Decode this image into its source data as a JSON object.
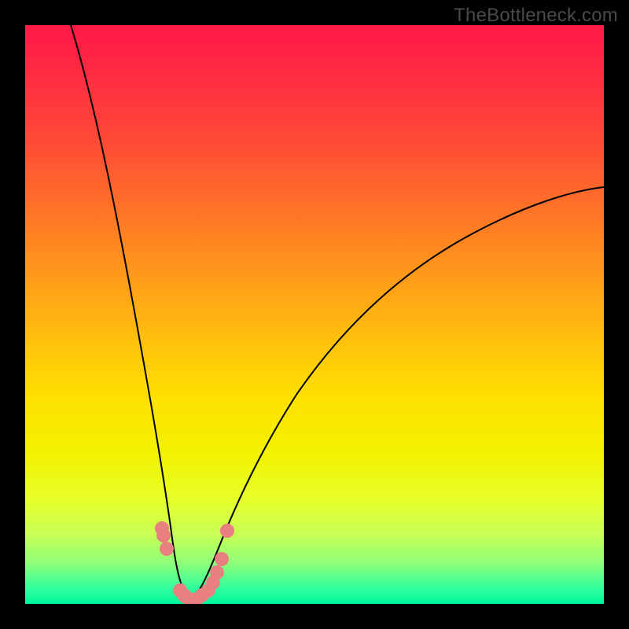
{
  "watermark": "TheBottleneck.com",
  "chart_data": {
    "type": "line",
    "title": "",
    "xlabel": "",
    "ylabel": "",
    "xlim": [
      0,
      100
    ],
    "ylim": [
      0,
      100
    ],
    "series": [
      {
        "name": "left-curve",
        "x": [
          8,
          10,
          12,
          14,
          16,
          18,
          20,
          22,
          23.5,
          24.5,
          25,
          25.5,
          26,
          27,
          28,
          29
        ],
        "y": [
          100,
          90,
          80,
          70,
          60,
          50,
          40,
          30,
          22,
          16,
          12,
          8,
          5,
          2.5,
          1,
          0
        ]
      },
      {
        "name": "right-curve",
        "x": [
          29,
          30,
          31,
          32,
          33.5,
          35,
          37,
          40,
          45,
          52,
          60,
          70,
          82,
          95,
          100
        ],
        "y": [
          0,
          1,
          2,
          4,
          7,
          10,
          14,
          20,
          28,
          38,
          46,
          54,
          62,
          69,
          71
        ]
      }
    ],
    "markers": {
      "name": "highlight-dots",
      "color": "#e98080",
      "points": [
        {
          "x": 23.6,
          "y": 12.8
        },
        {
          "x": 23.9,
          "y": 11.6
        },
        {
          "x": 24.4,
          "y": 9.2
        },
        {
          "x": 26.8,
          "y": 2.2
        },
        {
          "x": 27.6,
          "y": 1.4
        },
        {
          "x": 28.4,
          "y": 0.8
        },
        {
          "x": 29.6,
          "y": 0.8
        },
        {
          "x": 30.6,
          "y": 1.4
        },
        {
          "x": 31.6,
          "y": 2.2
        },
        {
          "x": 32.4,
          "y": 3.6
        },
        {
          "x": 33.2,
          "y": 5.4
        },
        {
          "x": 34.0,
          "y": 7.8
        },
        {
          "x": 34.9,
          "y": 12.4
        }
      ]
    }
  }
}
